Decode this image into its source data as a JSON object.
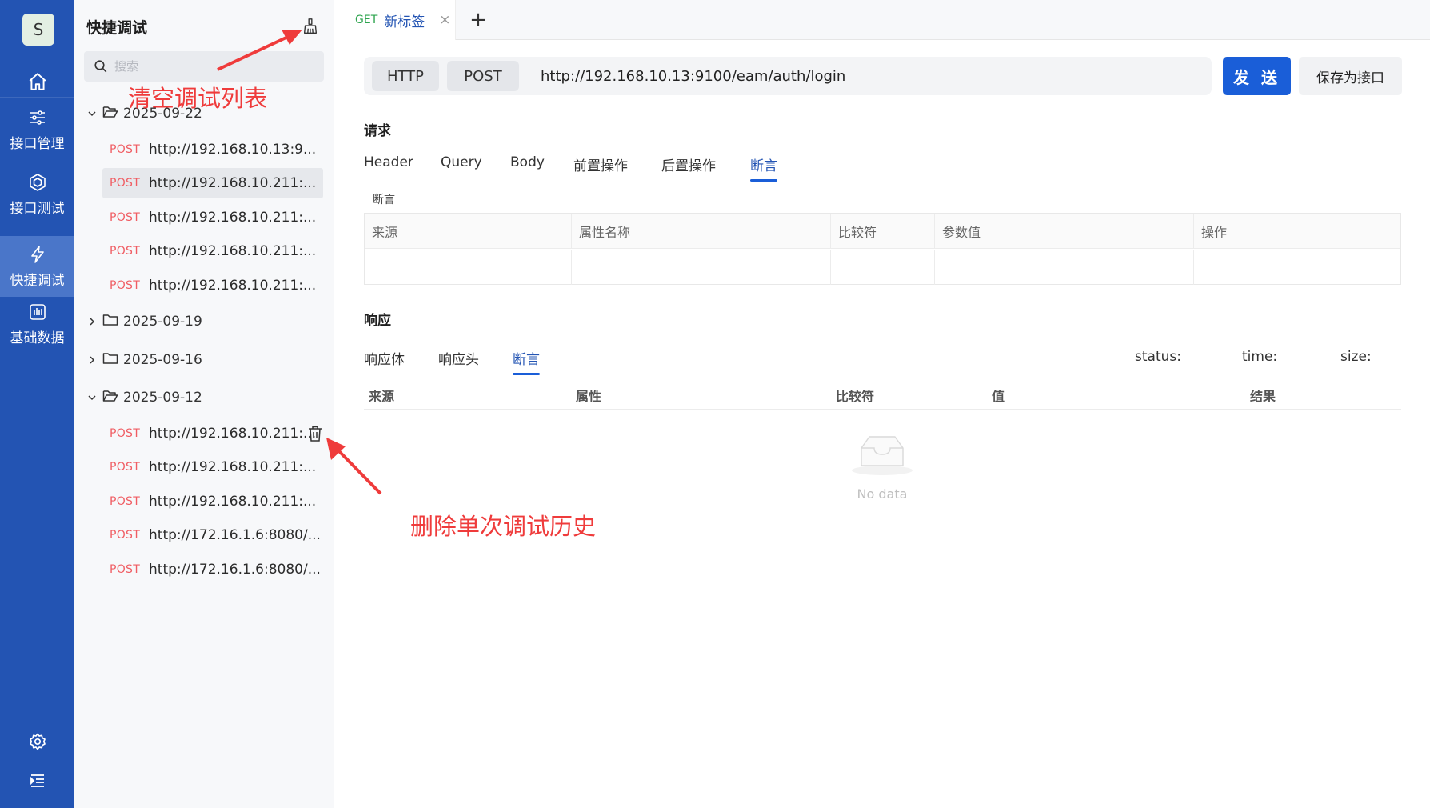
{
  "nav": {
    "avatar": "S",
    "items": [
      {
        "label": "接口管理",
        "icon": "sliders-icon"
      },
      {
        "label": "接口测试",
        "icon": "cube-icon"
      },
      {
        "label": "快捷调试",
        "icon": "lightning-icon"
      },
      {
        "label": "基础数据",
        "icon": "chart-icon"
      }
    ],
    "active_index": 2,
    "bottom_icons": [
      "gear-icon",
      "indent-menu-icon"
    ]
  },
  "sidebar": {
    "title": "快捷调试",
    "search_placeholder": "搜索",
    "groups": [
      {
        "date": "2025-09-22",
        "expanded": true,
        "entries": [
          {
            "method": "POST",
            "url": "http://192.168.10.13:9..."
          },
          {
            "method": "POST",
            "url": "http://192.168.10.211:..."
          },
          {
            "method": "POST",
            "url": "http://192.168.10.211:..."
          },
          {
            "method": "POST",
            "url": "http://192.168.10.211:..."
          },
          {
            "method": "POST",
            "url": "http://192.168.10.211:..."
          }
        ]
      },
      {
        "date": "2025-09-19",
        "expanded": false,
        "entries": []
      },
      {
        "date": "2025-09-16",
        "expanded": false,
        "entries": []
      },
      {
        "date": "2025-09-12",
        "expanded": true,
        "entries": [
          {
            "method": "POST",
            "url": "http://192.168.10.211:..."
          },
          {
            "method": "POST",
            "url": "http://192.168.10.211:..."
          },
          {
            "method": "POST",
            "url": "http://192.168.10.211:..."
          },
          {
            "method": "POST",
            "url": "http://172.16.1.6:8080/..."
          },
          {
            "method": "POST",
            "url": "http://172.16.1.6:8080/..."
          }
        ]
      }
    ]
  },
  "annotations": {
    "clear_list": "清空调试列表",
    "delete_single": "删除单次调试历史"
  },
  "tabs": {
    "items": [
      {
        "method": "GET",
        "title": "新标签",
        "close": "×"
      }
    ],
    "add": "+"
  },
  "request_bar": {
    "protocol": "HTTP",
    "method": "POST",
    "url": "http://192.168.10.13:9100/eam/auth/login",
    "send_label": "发 送",
    "save_label": "保存为接口"
  },
  "request": {
    "title": "请求",
    "tabs": [
      "Header",
      "Query",
      "Body",
      "前置操作",
      "后置操作",
      "断言"
    ],
    "active_tab": "断言",
    "assert_label": "断言",
    "table_headers": [
      "来源",
      "属性名称",
      "比较符",
      "参数值",
      "操作"
    ]
  },
  "response": {
    "title": "响应",
    "tabs": [
      "响应体",
      "响应头",
      "断言"
    ],
    "active_tab": "断言",
    "status_label": "status:",
    "time_label": "time:",
    "size_label": "size:",
    "table_headers": [
      "来源",
      "属性",
      "比较符",
      "值",
      "结果"
    ],
    "empty_text": "No data"
  },
  "colors": {
    "nav_bg": "#2354b3",
    "accent": "#1a5ed8",
    "method_post": "#f05d63",
    "method_get": "#2ea44f",
    "annotation": "#ef3b3b"
  }
}
